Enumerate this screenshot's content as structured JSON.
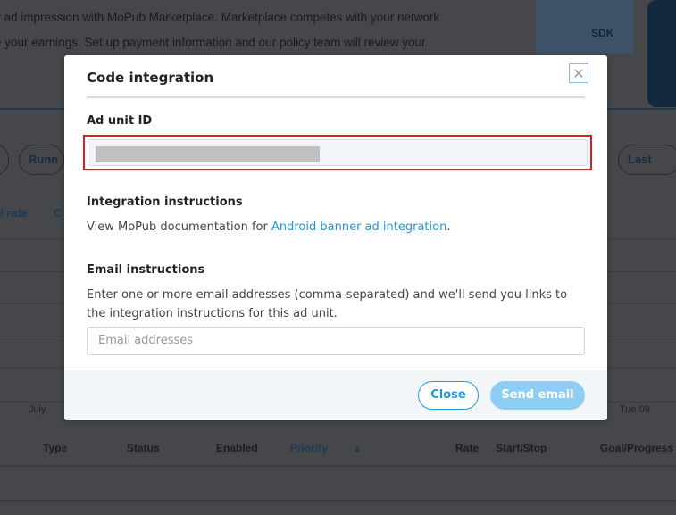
{
  "background": {
    "intro_lines": [
      "y ad impression with MoPub Marketplace. Marketplace competes with your network",
      "e your earnings. Set up payment information and our policy team will review your"
    ],
    "pills": [
      "Runn",
      "Last"
    ],
    "metric_tabs": [
      "l rate",
      "C"
    ],
    "chart_labels": [
      "July",
      "Tue 09"
    ],
    "table_headers": [
      "Type",
      "Status",
      "Enabled",
      "Priority",
      "Rate",
      "Start/Stop",
      "Goal/Progress"
    ],
    "sdk_label": "SDK"
  },
  "dialog": {
    "title": "Code integration",
    "close_icon": "close-x",
    "ad_unit_label": "Ad unit ID",
    "integration_label": "Integration instructions",
    "integration_text": "View MoPub documentation for ",
    "integration_link": "Android banner ad integration",
    "integration_suffix": ".",
    "email_label": "Email instructions",
    "email_text": "Enter one or more email addresses (comma-separated) and we'll send you links to the integration instructions for this ad unit.",
    "email_placeholder": "Email addresses",
    "close_button": "Close",
    "send_button": "Send email"
  },
  "colors": {
    "accent": "#1a9be0",
    "highlight": "#e31b23",
    "send_disabled": "#8ecdf4"
  }
}
